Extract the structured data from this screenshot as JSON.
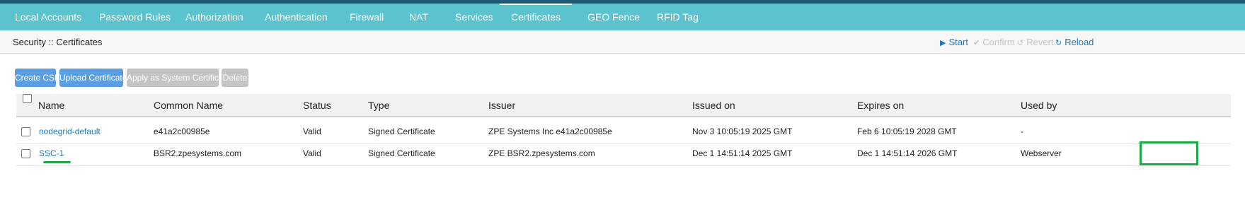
{
  "nav": {
    "tabs": [
      {
        "label": "Local Accounts"
      },
      {
        "label": "Password Rules"
      },
      {
        "label": "Authorization"
      },
      {
        "label": "Authentication"
      },
      {
        "label": "Firewall"
      },
      {
        "label": "NAT"
      },
      {
        "label": "Services"
      },
      {
        "label": "Certificates",
        "active": true
      },
      {
        "label": "GEO Fence"
      },
      {
        "label": "RFID Tag"
      }
    ]
  },
  "breadcrumb": "Security :: Certificates",
  "actions": {
    "start": {
      "icon": "play-icon",
      "label": "Start",
      "enabled": true
    },
    "confirm": {
      "icon": "check-icon",
      "label": "Confirm",
      "enabled": false
    },
    "revert": {
      "icon": "revert-icon",
      "label": "Revert",
      "enabled": false
    },
    "reload": {
      "icon": "reload-icon",
      "label": "Reload",
      "enabled": true
    }
  },
  "toolbar": {
    "create_csr": "Create CSR",
    "upload_certificate": "Upload Certificate",
    "apply_system_certificate": "Apply as System Certificate",
    "delete": "Delete"
  },
  "table": {
    "columns": [
      "Name",
      "Common Name",
      "Status",
      "Type",
      "Issuer",
      "Issued on",
      "Expires on",
      "Used by"
    ],
    "rows": [
      {
        "name": "nodegrid-default",
        "common_name": "e41a2c00985e",
        "status": "Valid",
        "type": "Signed Certificate",
        "issuer": "ZPE Systems Inc e41a2c00985e",
        "issued_on": "Nov 3 10:05:19 2025 GMT",
        "expires_on": "Feb 6 10:05:19 2028 GMT",
        "used_by": "-"
      },
      {
        "name": "SSC-1",
        "common_name": "BSR2.zpesystems.com",
        "status": "Valid",
        "type": "Signed Certificate",
        "issuer": "ZPE BSR2.zpesystems.com",
        "issued_on": "Dec 1 14:51:14 2025 GMT",
        "expires_on": "Dec 1 14:51:14 2026 GMT",
        "used_by": "Webserver"
      }
    ]
  },
  "colors": {
    "nav_bg": "#5bc3cd",
    "top_strip": "#1e5a73",
    "link": "#1c7bbd",
    "primary_button": "#5b9fe0",
    "disabled_button": "#c4c4c4",
    "annotation": "#23a94a"
  }
}
